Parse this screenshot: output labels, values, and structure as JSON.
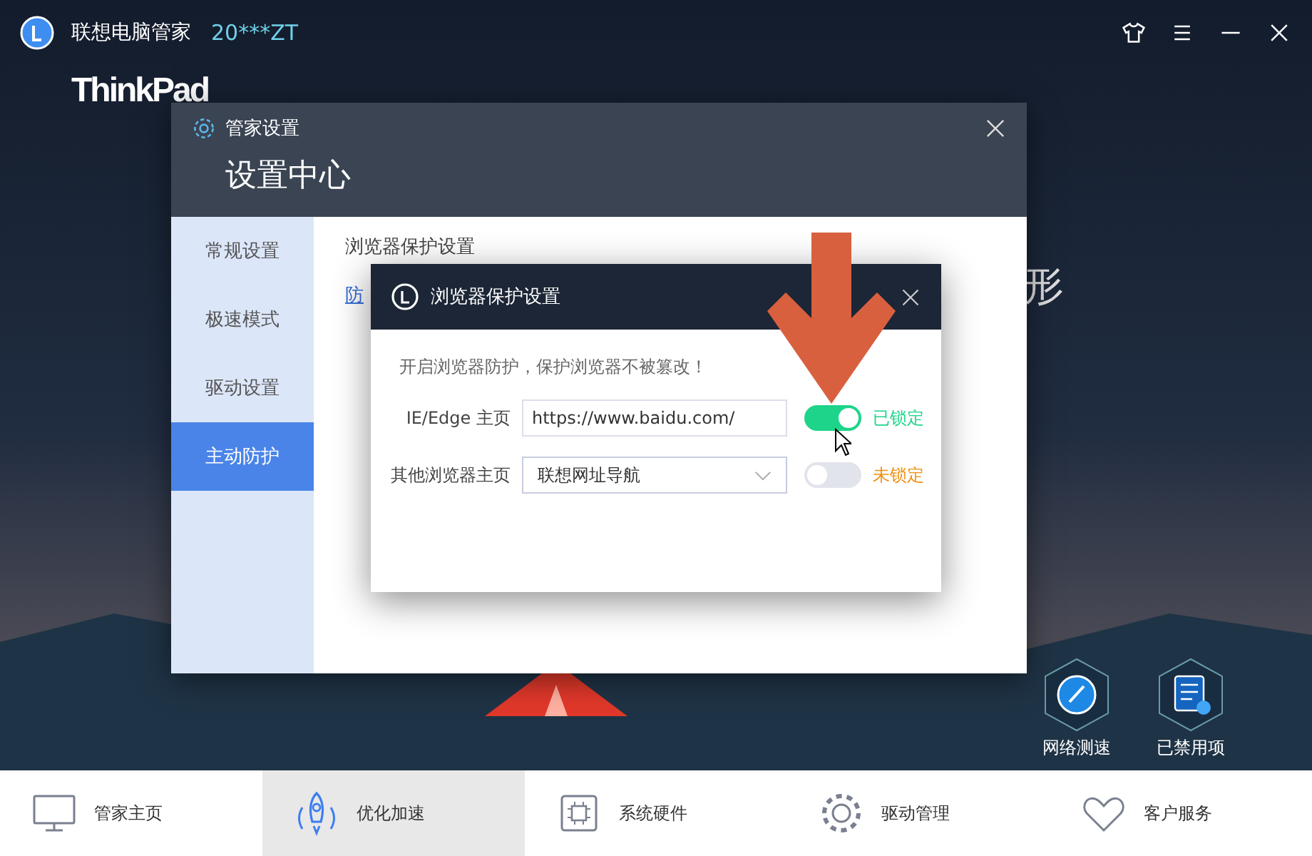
{
  "app": {
    "title": "联想电脑管家",
    "account": "20***ZT",
    "brand": "ThinkPad",
    "background_text": "形"
  },
  "settings_window": {
    "title": "管家设置",
    "heading": "设置中心",
    "section_title": "浏览器保护设置",
    "link": "防",
    "sidebar": [
      {
        "label": "常规设置",
        "selected": false
      },
      {
        "label": "极速模式",
        "selected": false
      },
      {
        "label": "驱动设置",
        "selected": false
      },
      {
        "label": "主动防护",
        "selected": true
      }
    ]
  },
  "dialog": {
    "title": "浏览器保护设置",
    "intro": "开启浏览器防护，保护浏览器不被篡改！",
    "rows": [
      {
        "kind": "input",
        "label": "IE/Edge 主页",
        "value": "https://www.baidu.com/",
        "on": true,
        "status": "已锁定"
      },
      {
        "kind": "select",
        "label": "其他浏览器主页",
        "value": "联想网址导航",
        "on": false,
        "status": "未锁定"
      }
    ]
  },
  "shortcuts": [
    {
      "kind": "speed",
      "label": "网络测速"
    },
    {
      "kind": "disabled",
      "label": "已禁用项"
    }
  ],
  "nav": [
    {
      "kind": "home",
      "label": "管家主页",
      "selected": false
    },
    {
      "kind": "rocket",
      "label": "优化加速",
      "selected": true
    },
    {
      "kind": "chip",
      "label": "系统硬件",
      "selected": false
    },
    {
      "kind": "gear",
      "label": "驱动管理",
      "selected": false
    },
    {
      "kind": "heart",
      "label": "客户服务",
      "selected": false
    }
  ]
}
